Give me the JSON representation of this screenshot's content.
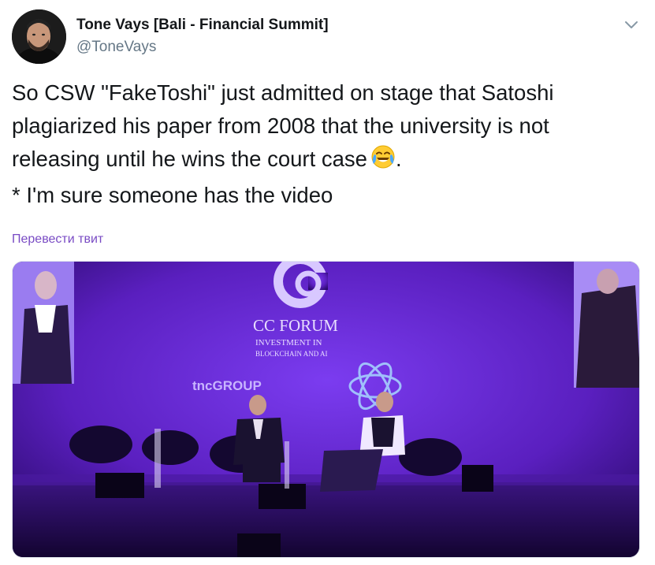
{
  "author": {
    "name": "Tone Vays [Bali - Financial Summit]",
    "handle": "@ToneVays"
  },
  "tweet": {
    "lines": [
      "So CSW \"FakeToshi\" just admitted on stage that Satoshi",
      "plagiarized his paper from 2008 that the university is not",
      "releasing until he wins the court case",
      "* I'm sure someone has the video"
    ],
    "line3_suffix": ".",
    "emoji": "face-with-tears-of-joy"
  },
  "translate_label": "Перевести твит",
  "photo": {
    "banner_title": "CC FORUM",
    "banner_sub1": "INVESTMENT IN",
    "banner_sub2": "BLOCKCHAIN AND AI",
    "sponsor": "tncGROUP"
  },
  "colors": {
    "stage_purple": "#5a1fbf",
    "translate_link": "#794bc4"
  },
  "icons": [
    "chevron-down-icon",
    "face-with-tears-of-joy-icon"
  ]
}
